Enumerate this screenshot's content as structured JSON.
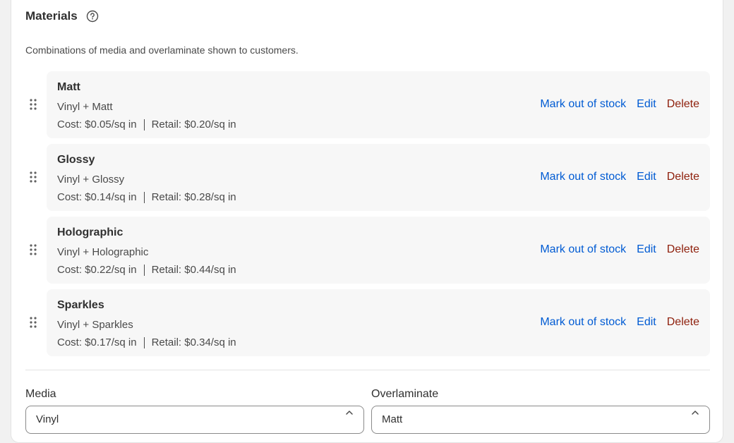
{
  "section": {
    "title": "Materials",
    "help_icon": "question-circle-icon",
    "subtitle": "Combinations of media and overlaminate shown to customers."
  },
  "materials": [
    {
      "name": "Matt",
      "combo": "Vinyl + Matt",
      "cost": "Cost: $0.05/sq in",
      "retail": "Retail: $0.20/sq in"
    },
    {
      "name": "Glossy",
      "combo": "Vinyl + Glossy",
      "cost": "Cost: $0.14/sq in",
      "retail": "Retail: $0.28/sq in"
    },
    {
      "name": "Holographic",
      "combo": "Vinyl + Holographic",
      "cost": "Cost: $0.22/sq in",
      "retail": "Retail: $0.44/sq in"
    },
    {
      "name": "Sparkles",
      "combo": "Vinyl + Sparkles",
      "cost": "Cost: $0.17/sq in",
      "retail": "Retail: $0.34/sq in"
    }
  ],
  "actions": {
    "mark_out": "Mark out of stock",
    "edit": "Edit",
    "delete": "Delete"
  },
  "form": {
    "media_label": "Media",
    "media_value": "Vinyl",
    "overlaminate_label": "Overlaminate",
    "overlaminate_value": "Matt"
  },
  "colors": {
    "link": "#005bd3",
    "danger": "#8e1f0b",
    "row_bg": "#f7f7f7"
  }
}
